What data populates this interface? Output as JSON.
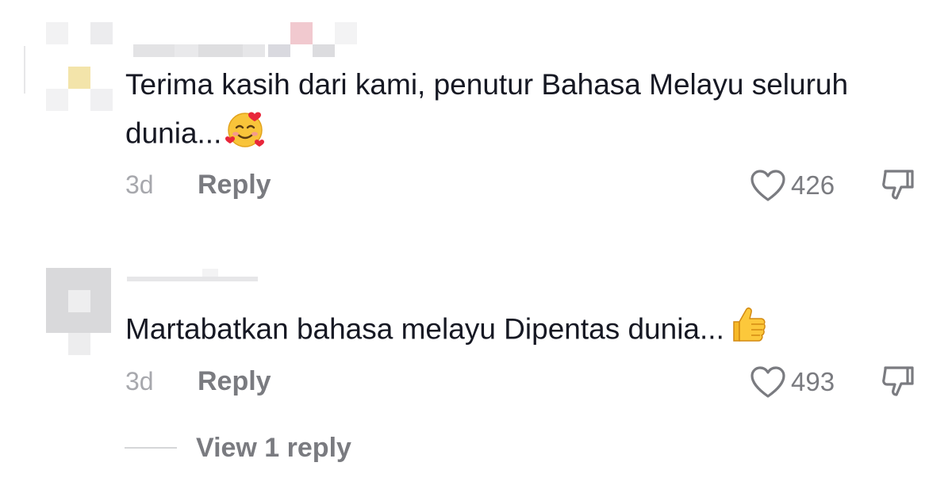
{
  "comments": [
    {
      "text": "Terima kasih dari kami, penutur Bahasa Melayu seluruh dunia...",
      "emoji": "smiling-face-with-hearts",
      "time": "3d",
      "reply_label": "Reply",
      "likes": "426"
    },
    {
      "text": "Martabatkan bahasa melayu Dipentas dunia...",
      "emoji": "thumbs-up",
      "time": "3d",
      "reply_label": "Reply",
      "likes": "493",
      "view_replies_label": "View 1 reply"
    }
  ],
  "colors": {
    "text_primary": "#161823",
    "text_secondary": "#7a7b80",
    "text_time": "#a7a8ad",
    "pixelation_gray": "#e4e4e6",
    "pixelation_yellow": "#f3e4aa",
    "pixelation_pink": "#f1c9cf"
  },
  "icons": [
    "heart-outline-icon",
    "thumbs-down-icon",
    "smiling-face-with-hearts-emoji",
    "thumbs-up-emoji"
  ]
}
